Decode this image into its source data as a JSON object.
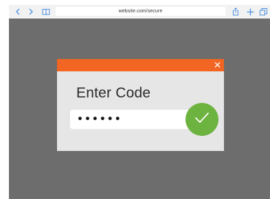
{
  "browser": {
    "url": "website.com/secure",
    "accent_color": "#4a8fe0",
    "icons": [
      "chevron-left-icon",
      "chevron-right-icon",
      "book-icon",
      "share-icon",
      "plus-icon",
      "tabs-icon"
    ]
  },
  "page": {
    "background_color": "#6c6d6c"
  },
  "modal": {
    "header_color": "#f26522",
    "title": "Enter Code",
    "input_value": "••••••",
    "submit_color": "#6db33f",
    "close_icon": "close-icon",
    "submit_icon": "checkmark-icon"
  }
}
